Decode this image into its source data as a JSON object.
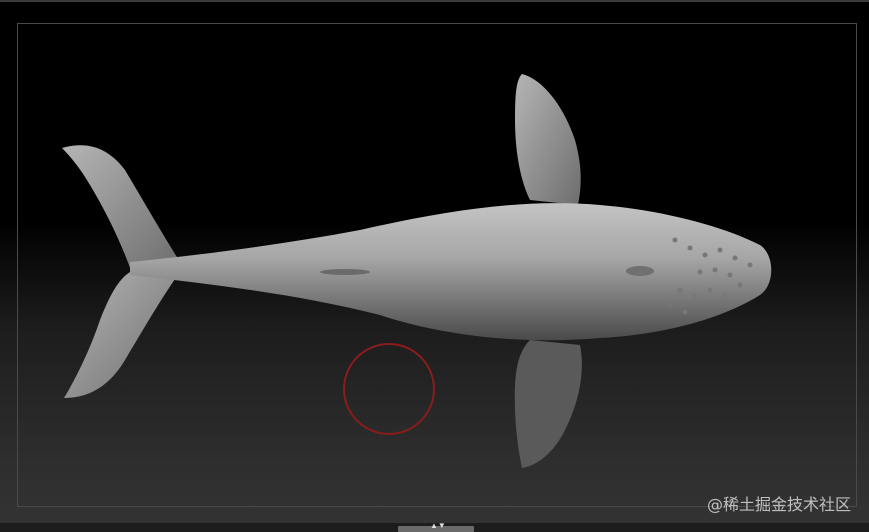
{
  "viewport": {
    "model": "humpback-whale",
    "cursor": "brush-circle-icon"
  },
  "bottom_bar": {
    "handle_icon": "▲▼"
  },
  "watermark": "@稀土掘金技术社区",
  "colors": {
    "brush": "#8a1c1c",
    "model": "#9a9a9a",
    "frame": "#4a4a4a"
  }
}
